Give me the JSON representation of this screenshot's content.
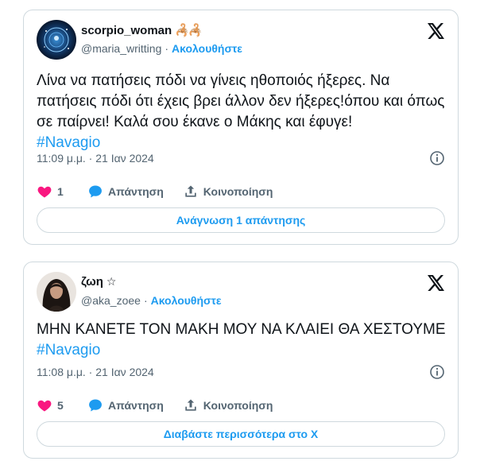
{
  "tweets": [
    {
      "display_name": "scorpio_woman",
      "name_decoration": "🦂🦂",
      "handle": "@maria_writting",
      "separator": "·",
      "follow_label": "Ακολουθήστε",
      "text": "Λίνα να πατήσεις πόδι να γίνεις ηθοποιός ήξερες. Να πατήσεις πόδι ότι έχεις βρει άλλον δεν ήξερες!όπου και όπως σε παίρνει! Καλά σου έκανε ο Μάκης και έφυγε!",
      "hashtag": "#Navagio",
      "timestamp": "11:09 μ.μ. · 21 Ιαν 2024",
      "like_count": "1",
      "reply_label": "Απάντηση",
      "share_label": "Κοινοποίηση",
      "bottom_button_label": "Ανάγνωση 1 απάντησης",
      "avatar_icon": "zodiac-galaxy-avatar",
      "accent": "#1d9bf0",
      "like_color": "#f91880"
    },
    {
      "display_name": "ζωη",
      "name_decoration": "☆",
      "handle": "@aka_zoee",
      "separator": "·",
      "follow_label": "Ακολουθήστε",
      "text": "ΜΗΝ ΚΑΝΕΤΕ ΤΟΝ ΜΑΚΗ ΜΟΥ ΝΑ ΚΛΑΙΕΙ ΘΑ ΧΕΣΤΟΥΜΕ",
      "hashtag": "#Navagio",
      "timestamp": "11:08 μ.μ. · 21 Ιαν 2024",
      "like_count": "5",
      "reply_label": "Απάντηση",
      "share_label": "Κοινοποίηση",
      "bottom_button_label": "Διαβάστε περισσότερα στο X",
      "avatar_icon": "woman-portrait-avatar",
      "accent": "#1d9bf0",
      "like_color": "#f91880"
    }
  ]
}
